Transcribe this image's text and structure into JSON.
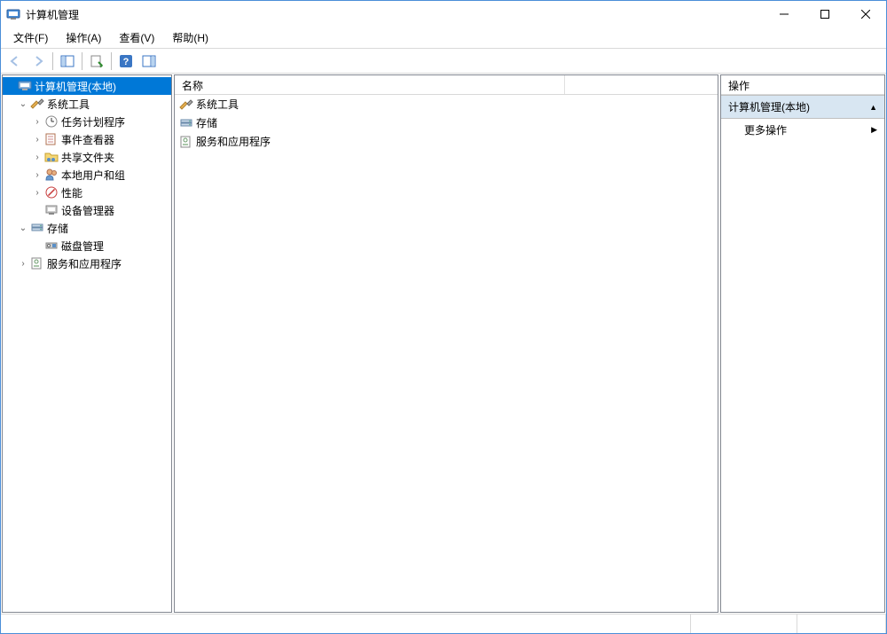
{
  "window": {
    "title": "计算机管理"
  },
  "menu": {
    "file": "文件(F)",
    "action": "操作(A)",
    "view": "查看(V)",
    "help": "帮助(H)"
  },
  "tree": {
    "root": "计算机管理(本地)",
    "system_tools": "系统工具",
    "task_scheduler": "任务计划程序",
    "event_viewer": "事件查看器",
    "shared_folders": "共享文件夹",
    "local_users": "本地用户和组",
    "performance": "性能",
    "device_manager": "设备管理器",
    "storage": "存储",
    "disk_management": "磁盘管理",
    "services_apps": "服务和应用程序"
  },
  "list": {
    "header_name": "名称",
    "items": [
      "系统工具",
      "存储",
      "服务和应用程序"
    ]
  },
  "actions": {
    "header": "操作",
    "node_title": "计算机管理(本地)",
    "more_actions": "更多操作"
  }
}
